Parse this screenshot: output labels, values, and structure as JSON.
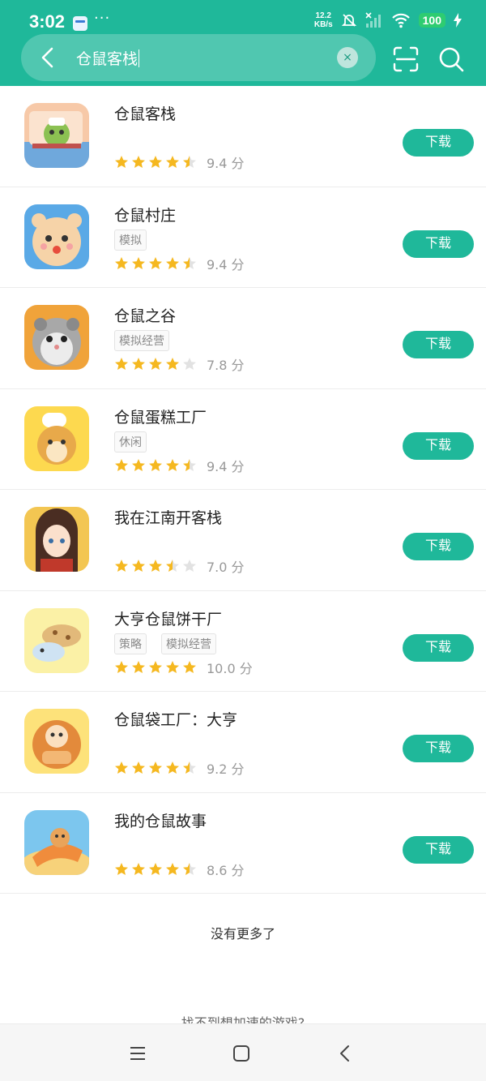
{
  "status_bar": {
    "time": "3:02",
    "more": "···",
    "net_speed_value": "12.2",
    "net_speed_unit": "KB/s",
    "battery": "100"
  },
  "search": {
    "query": "仓鼠客栈",
    "clear_symbol": "×"
  },
  "download_label": "下载",
  "score_unit": "分",
  "apps": [
    {
      "name": "仓鼠客栈",
      "tags": [],
      "rating": 4.5,
      "score": "9.4"
    },
    {
      "name": "仓鼠村庄",
      "tags": [
        "模拟"
      ],
      "rating": 4.5,
      "score": "9.4"
    },
    {
      "name": "仓鼠之谷",
      "tags": [
        "模拟经营"
      ],
      "rating": 4,
      "score": "7.8"
    },
    {
      "name": "仓鼠蛋糕工厂",
      "tags": [
        "休闲"
      ],
      "rating": 4.5,
      "score": "9.4"
    },
    {
      "name": "我在江南开客栈",
      "tags": [],
      "rating": 3.5,
      "score": "7.0"
    },
    {
      "name": "大亨仓鼠饼干厂",
      "tags": [
        "策略",
        "模拟经营"
      ],
      "rating": 5,
      "score": "10.0"
    },
    {
      "name": "仓鼠袋工厂：大亨",
      "tags": [],
      "rating": 4.5,
      "score": "9.2"
    },
    {
      "name": "我的仓鼠故事",
      "tags": [],
      "rating": 4.5,
      "score": "8.6"
    }
  ],
  "footer": {
    "no_more": "没有更多了",
    "hint": "找不到想加速的游戏?"
  },
  "colors": {
    "accent": "#1fb89a",
    "star": "#f5b820",
    "star_empty": "#e2e2e2"
  }
}
